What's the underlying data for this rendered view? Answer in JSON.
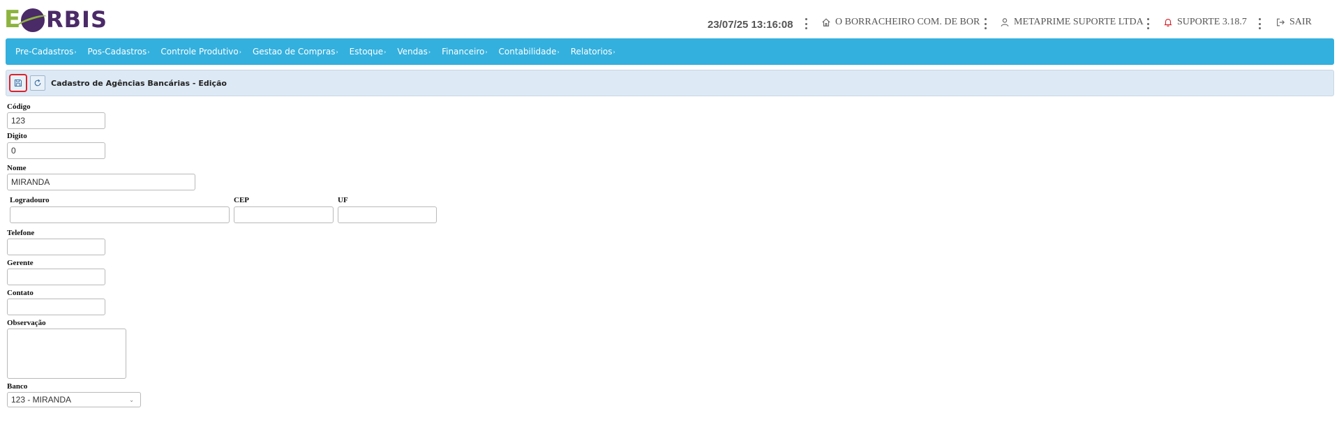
{
  "logo": {
    "text_e": "E",
    "text_rbis": "RBIS",
    "primary_color": "#4b2a68",
    "accent_color": "#8db33f"
  },
  "header": {
    "datetime": "23/07/25 13:16:08",
    "company": "O BORRACHEIRO COM. DE BOR",
    "user": "METAPRIME SUPORTE LTDA",
    "support": "SUPORTE 3.18.7",
    "logout": "SAIR",
    "icons": {
      "company": "home-icon",
      "user": "user-icon",
      "support": "bell-icon",
      "logout": "logout-icon"
    }
  },
  "nav": {
    "color": "#33b0de",
    "items": [
      {
        "label": "Pre-Cadastros",
        "caret": "›"
      },
      {
        "label": "Pos-Cadastros",
        "caret": "›"
      },
      {
        "label": "Controle Produtivo",
        "caret": "›"
      },
      {
        "label": "Gestao de Compras",
        "caret": "›"
      },
      {
        "label": "Estoque",
        "caret": "›"
      },
      {
        "label": "Vendas",
        "caret": "›"
      },
      {
        "label": "Financeiro",
        "caret": "›"
      },
      {
        "label": "Contabilidade",
        "caret": "›"
      },
      {
        "label": "Relatorios",
        "caret": "›"
      }
    ]
  },
  "toolbar": {
    "title": "Cadastro de Agências Bancárias - Edição",
    "buttons": {
      "save": "save-icon",
      "refresh": "refresh-icon"
    }
  },
  "form": {
    "codigo": {
      "label": "Código",
      "value": "123"
    },
    "digito": {
      "label": "Digito",
      "value": "0"
    },
    "nome": {
      "label": "Nome",
      "value": "MIRANDA"
    },
    "logradouro": {
      "label": "Logradouro",
      "value": ""
    },
    "cep": {
      "label": "CEP",
      "value": ""
    },
    "uf": {
      "label": "UF",
      "value": ""
    },
    "telefone": {
      "label": "Telefone",
      "value": ""
    },
    "gerente": {
      "label": "Gerente",
      "value": ""
    },
    "contato": {
      "label": "Contato",
      "value": ""
    },
    "observacao": {
      "label": "Observação",
      "value": ""
    },
    "banco": {
      "label": "Banco",
      "value": "123 - MIRANDA"
    }
  }
}
